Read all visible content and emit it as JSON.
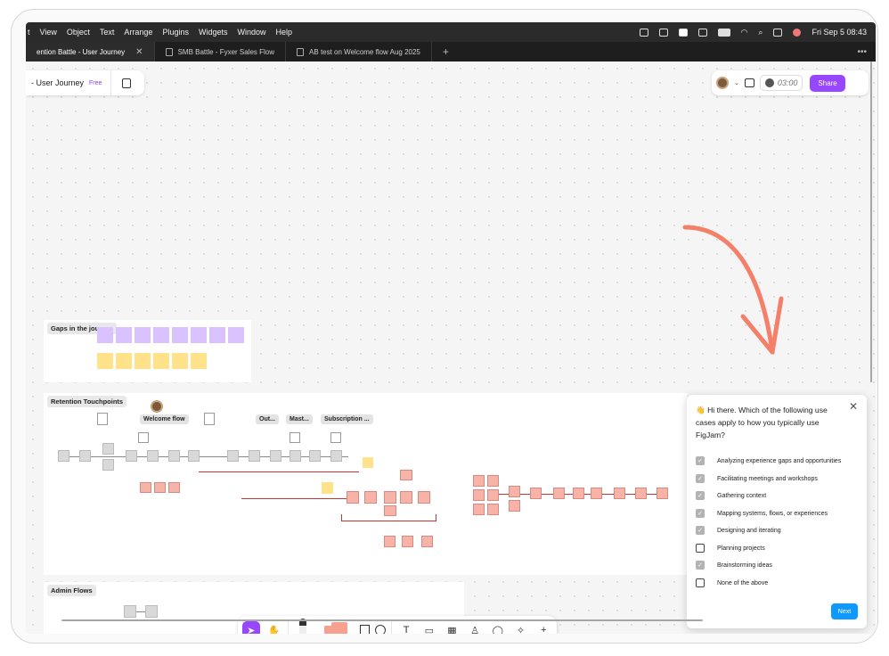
{
  "menubar": {
    "items": [
      "t",
      "View",
      "Object",
      "Text",
      "Arrange",
      "Plugins",
      "Widgets",
      "Window",
      "Help"
    ],
    "clock": "Fri Sep 5  08:43"
  },
  "tabs": [
    {
      "label": "ention Battle - User Journey",
      "active": true
    },
    {
      "label": "SMB Battle - Fyxer Sales Flow",
      "active": false
    },
    {
      "label": "AB test on Welcome flow Aug 2025",
      "active": false
    }
  ],
  "file": {
    "name": "- User Journey",
    "plan": "Free"
  },
  "header": {
    "timer": "03:00",
    "share_label": "Share"
  },
  "sections": {
    "gaps": "Gaps in the journey",
    "retention": "Retention Touchpoints",
    "admin": "Admin Flows"
  },
  "chips": [
    "Welcome flow",
    "Out...",
    "Mast...",
    "Subscription ..."
  ],
  "dialog": {
    "question": "👋 Hi there. Which of the following use cases apply to how you typically use FigJam?",
    "options": [
      {
        "label": "Analyzing experience gaps and opportunities",
        "checked": true
      },
      {
        "label": "Facilitating meetings and workshops",
        "checked": true
      },
      {
        "label": "Gathering context",
        "checked": true
      },
      {
        "label": "Mapping systems, flows, or experiences",
        "checked": true
      },
      {
        "label": "Designing and iterating",
        "checked": true
      },
      {
        "label": "Planning projects",
        "checked": false
      },
      {
        "label": "Brainstorming ideas",
        "checked": true
      },
      {
        "label": "None of the above",
        "checked": false
      }
    ],
    "next_label": "Next"
  },
  "colors": {
    "accent": "#9747ff",
    "next": "#0d99ff",
    "arrow": "#f4806a"
  }
}
